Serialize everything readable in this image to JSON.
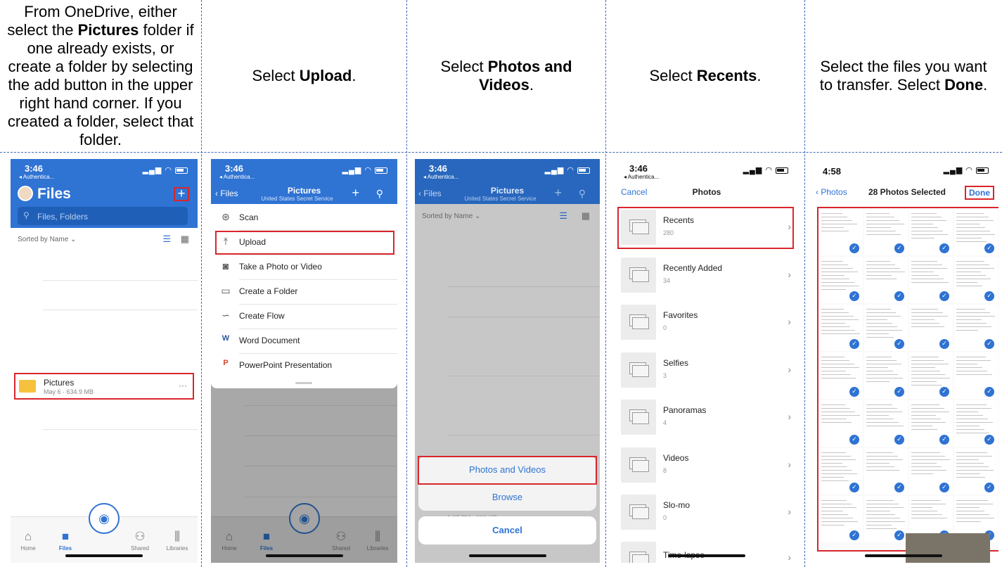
{
  "instructions": [
    {
      "pre": "From OneDrive, either select the ",
      "bold": "Pictures",
      "post": " folder if one already exists, or create a folder by selecting the add button in the upper right hand corner. If you created a folder, select that folder."
    },
    {
      "pre": "Select ",
      "bold": "Upload",
      "post": "."
    },
    {
      "pre": "Select ",
      "bold": "Photos and Videos",
      "post": "."
    },
    {
      "pre": "Select ",
      "bold": "Recents",
      "post": "."
    },
    {
      "pre": "Select the files you want to transfer. Select ",
      "bold": "Done",
      "post": "."
    }
  ],
  "status": {
    "time_a": "3:46",
    "time_b": "4:58",
    "back_app": "◂ Authentica..."
  },
  "screen1": {
    "title": "Files",
    "search_placeholder": "Files, Folders",
    "sort": "Sorted by Name ⌄",
    "folder_name": "Pictures",
    "folder_meta": "May 6 · 634.9 MB",
    "more": "···"
  },
  "screen2": {
    "back": "Files",
    "title": "Pictures",
    "subtitle": "United States Secret Service",
    "menu": [
      "Scan",
      "Upload",
      "Take a Photo or Video",
      "Create a Folder",
      "Create Flow",
      "Word Document",
      "PowerPoint Presentation"
    ]
  },
  "screen3": {
    "back": "Files",
    "title": "Pictures",
    "subtitle": "United States Secret Service",
    "sort": "Sorted by Name ⌄",
    "sheet_option_1": "Photos and Videos",
    "sheet_option_2": "Browse",
    "cancel": "Cancel",
    "partial_row": "1:22 PM · 601 KB"
  },
  "screen4": {
    "cancel": "Cancel",
    "title": "Photos",
    "albums": [
      {
        "name": "Recents",
        "count": "280"
      },
      {
        "name": "Recently Added",
        "count": "34"
      },
      {
        "name": "Favorites",
        "count": "0"
      },
      {
        "name": "Selfies",
        "count": "3"
      },
      {
        "name": "Panoramas",
        "count": "4"
      },
      {
        "name": "Videos",
        "count": "8"
      },
      {
        "name": "Slo-mo",
        "count": "0"
      },
      {
        "name": "Time-lapse",
        "count": ""
      }
    ]
  },
  "screen5": {
    "back": "Photos",
    "title": "28 Photos Selected",
    "done": "Done"
  },
  "tabs": [
    "Home",
    "Files",
    "Shared",
    "Libraries"
  ],
  "colors": {
    "accent": "#2f73d3",
    "highlight": "#d9262c"
  }
}
